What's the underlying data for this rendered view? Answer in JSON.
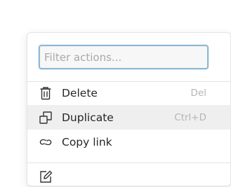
{
  "filter": {
    "placeholder": "Filter actions..."
  },
  "actions": [
    {
      "label": "Delete",
      "shortcut": "Del",
      "icon": "trash-icon"
    },
    {
      "label": "Duplicate",
      "shortcut": "Ctrl+D",
      "icon": "duplicate-icon",
      "highlighted": true
    },
    {
      "label": "Copy link",
      "shortcut": "",
      "icon": "link-icon"
    }
  ],
  "next_section_icon": "edit-icon",
  "colors": {
    "focus_border": "#8fb8d6",
    "hover_bg": "#efefef",
    "shortcut_text": "#b5b5b5"
  }
}
